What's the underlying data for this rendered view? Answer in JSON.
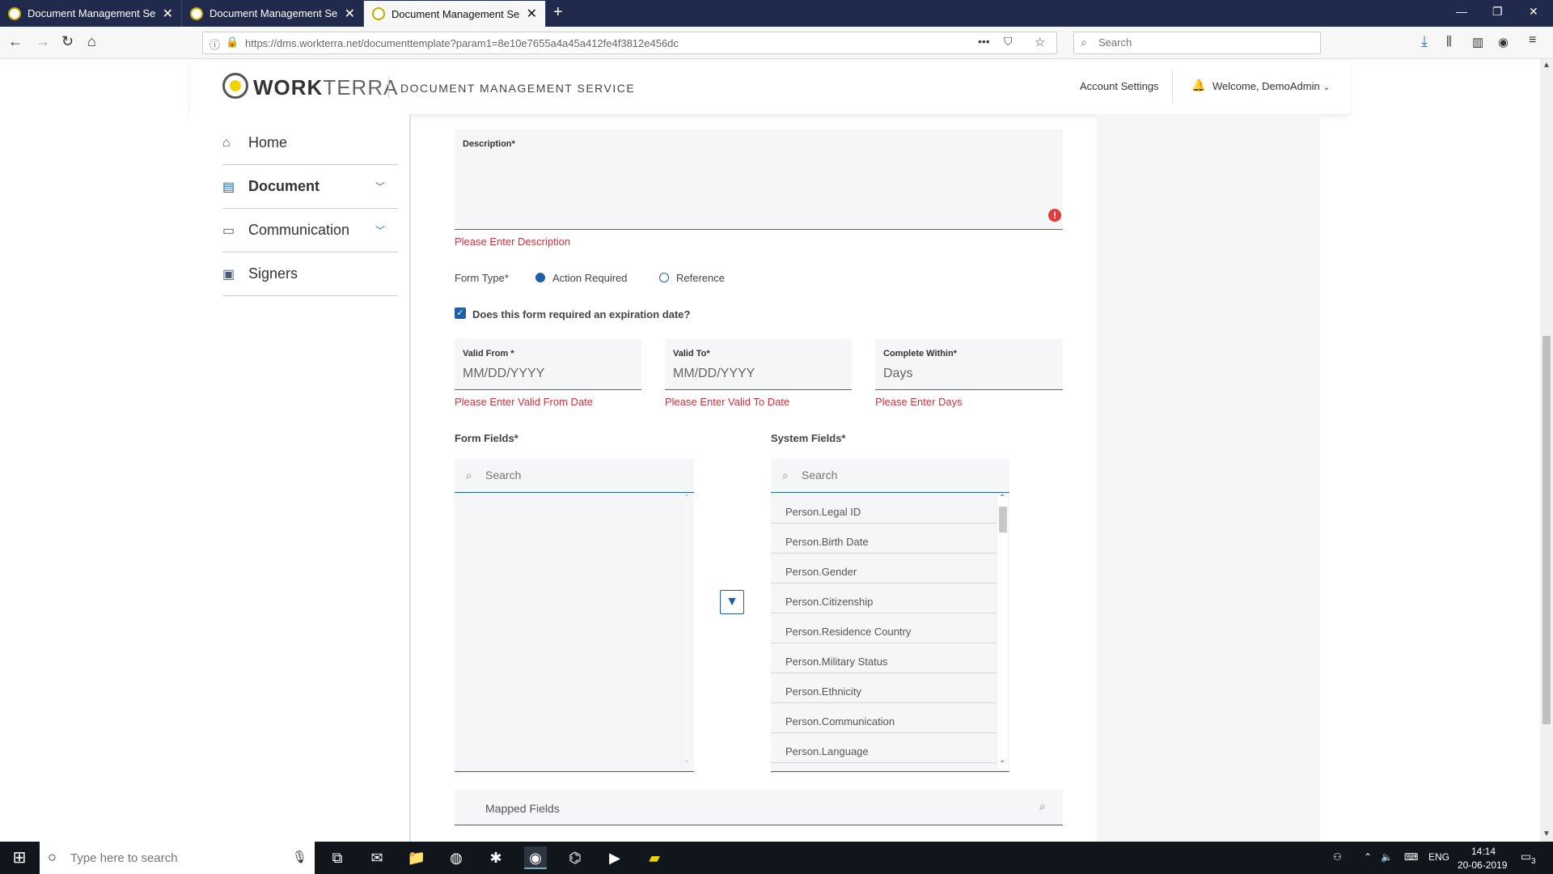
{
  "browser": {
    "tabs": [
      {
        "title": "Document Management Servic"
      },
      {
        "title": "Document Management Servic"
      },
      {
        "title": "Document Management Servic"
      }
    ],
    "url": "https://dms.workterra.net/documenttemplate?param1=8e10e7655a4a45a412fe4f3812e456dc",
    "search_placeholder": "Search",
    "window_controls": [
      "minimize",
      "restore",
      "close"
    ]
  },
  "app": {
    "logo_bold": "WORK",
    "logo_light": "TERRA",
    "title": "DOCUMENT MANAGEMENT SERVICE",
    "account_settings": "Account Settings",
    "welcome": "Welcome, DemoAdmin"
  },
  "sidebar": {
    "items": [
      {
        "label": "Home",
        "icon": "home-icon"
      },
      {
        "label": "Document",
        "icon": "document-icon",
        "selected": true
      },
      {
        "label": "Communication",
        "icon": "chat-icon"
      },
      {
        "label": "Signers",
        "icon": "signers-icon"
      }
    ]
  },
  "form": {
    "description_label": "Description*",
    "description_error": "Please Enter Description",
    "form_type_label": "Form Type*",
    "form_type_options": [
      "Action Required",
      "Reference"
    ],
    "form_type_selected": "Action Required",
    "expiration_label": "Does this form required an expiration date?",
    "expiration_checked": true,
    "valid_from_label": "Valid From *",
    "valid_from_placeholder": "MM/DD/YYYY",
    "valid_from_error": "Please Enter Valid From Date",
    "valid_to_label": "Valid To*",
    "valid_to_placeholder": "MM/DD/YYYY",
    "valid_to_error": "Please Enter Valid To Date",
    "complete_within_label": "Complete Within*",
    "complete_within_placeholder": "Days",
    "complete_within_error": "Please Enter Days",
    "form_fields_label": "Form Fields*",
    "form_fields_search_placeholder": "Search",
    "system_fields_label": "System Fields*",
    "system_fields_search_placeholder": "Search",
    "system_fields": [
      "Person.Legal ID",
      "Person.Birth Date",
      "Person.Gender",
      "Person.Citizenship",
      "Person.Residence Country",
      "Person.Military Status",
      "Person.Ethnicity",
      "Person.Communication",
      "Person.Language"
    ],
    "mapped_fields_label": "Mapped Fields"
  },
  "taskbar": {
    "search_placeholder": "Type here to search",
    "language": "ENG",
    "time": "14:14",
    "date": "20-06-2019",
    "notifications": "3"
  },
  "colors": {
    "accent": "#1f5fa8",
    "error": "#d0313a",
    "tabbar": "#1f2a4d"
  }
}
